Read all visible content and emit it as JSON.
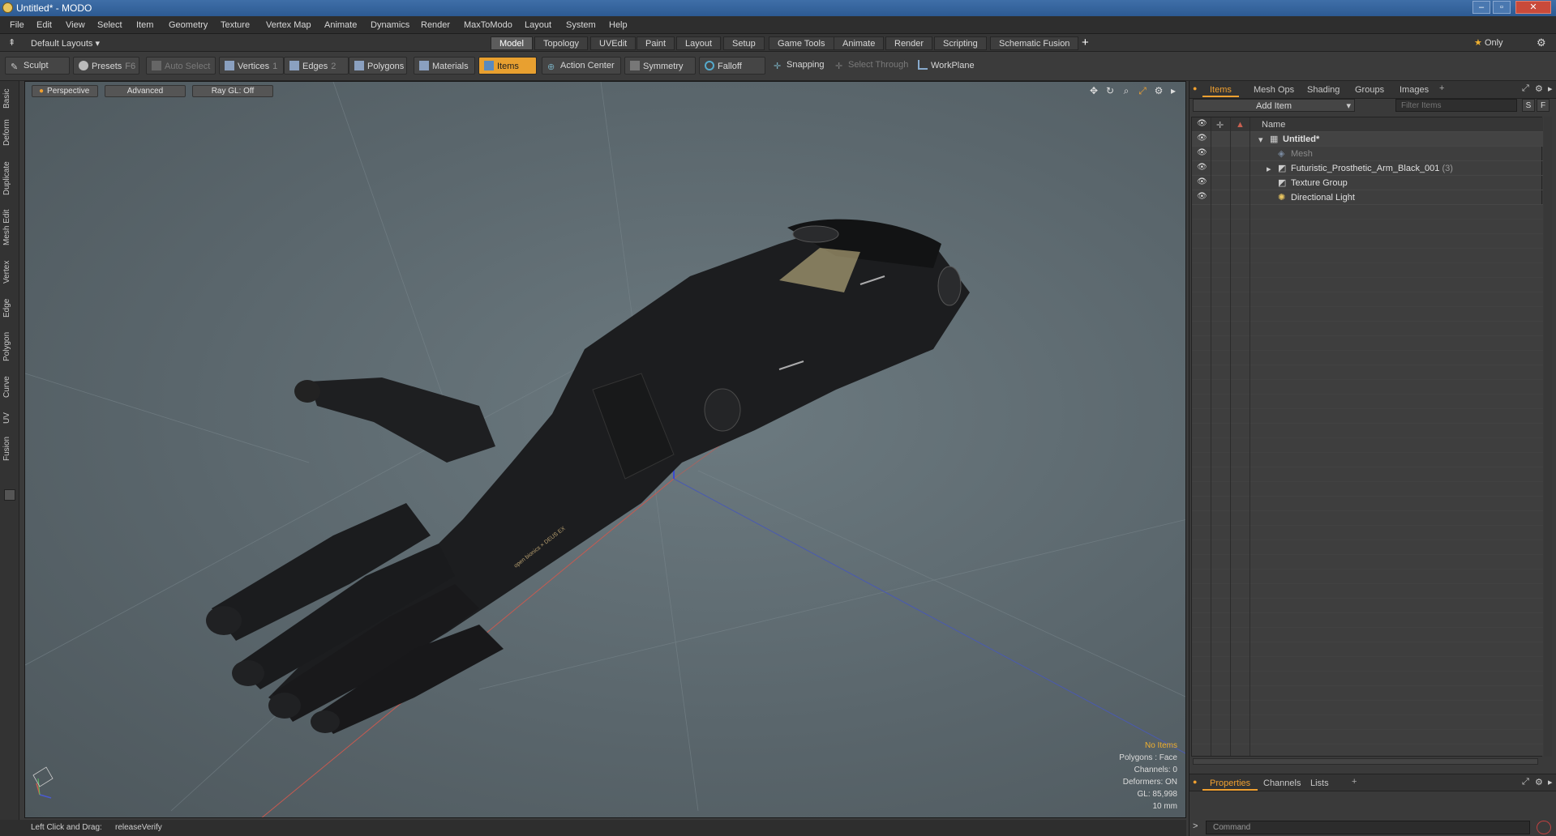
{
  "window": {
    "title": "Untitled* - MODO"
  },
  "menu": [
    "File",
    "Edit",
    "View",
    "Select",
    "Item",
    "Geometry",
    "Texture",
    "Vertex Map",
    "Animate",
    "Dynamics",
    "Render",
    "MaxToModo",
    "Layout",
    "System",
    "Help"
  ],
  "layouts": {
    "preset": "Default Layouts",
    "tabs": [
      "Model",
      "Topology",
      "UVEdit",
      "Paint",
      "Layout",
      "Setup",
      "Game Tools",
      "Animate",
      "Render",
      "Scripting",
      "Schematic Fusion"
    ],
    "add": "+",
    "only": "Only"
  },
  "toolbar": {
    "sculpt": "Sculpt",
    "presets": "Presets",
    "presets_key": "F6",
    "auto_select": "Auto Select",
    "vertices": "Vertices",
    "vertices_num": "1",
    "edges": "Edges",
    "edges_num": "2",
    "polygons": "Polygons",
    "materials": "Materials",
    "items": "Items",
    "action_center": "Action Center",
    "symmetry": "Symmetry",
    "falloff": "Falloff",
    "snapping": "Snapping",
    "select_through": "Select Through",
    "workplane": "WorkPlane"
  },
  "left_tabs": [
    "Basic",
    "Deform",
    "Duplicate",
    "Mesh Edit",
    "Vertex",
    "Edge",
    "Polygon",
    "Curve",
    "UV",
    "Fusion"
  ],
  "viewport": {
    "view": "Perspective",
    "shading": "Advanced",
    "raygl": "Ray GL: Off",
    "stats": {
      "items": "No Items",
      "polygons": "Polygons : Face",
      "channels": "Channels: 0",
      "deformers": "Deformers: ON",
      "gl": "GL: 85,998",
      "scale": "10 mm"
    },
    "model_text": "open bionics × DEUS EX"
  },
  "status": {
    "hint": "Left Click and Drag:",
    "action": "releaseVerify"
  },
  "right_panel": {
    "tabs": [
      "Items",
      "Mesh Ops",
      "Shading",
      "Groups",
      "Images"
    ],
    "add_item": "Add Item",
    "filter_placeholder": "Filter Items",
    "s_btn": "S",
    "f_btn": "F",
    "name_header": "Name",
    "items": [
      {
        "name": "Untitled*",
        "count": ""
      },
      {
        "name": "Mesh",
        "count": ""
      },
      {
        "name": "Futuristic_Prosthetic_Arm_Black_001",
        "count": "(3)"
      },
      {
        "name": "Texture Group",
        "count": ""
      },
      {
        "name": "Directional Light",
        "count": ""
      }
    ],
    "bottom_tabs": [
      "Properties",
      "Channels",
      "Lists"
    ],
    "command_placeholder": "Command"
  },
  "colors": {
    "accent": "#f0a030",
    "titlebar": "#3f6fa8",
    "viewport": "#5d6a70"
  }
}
